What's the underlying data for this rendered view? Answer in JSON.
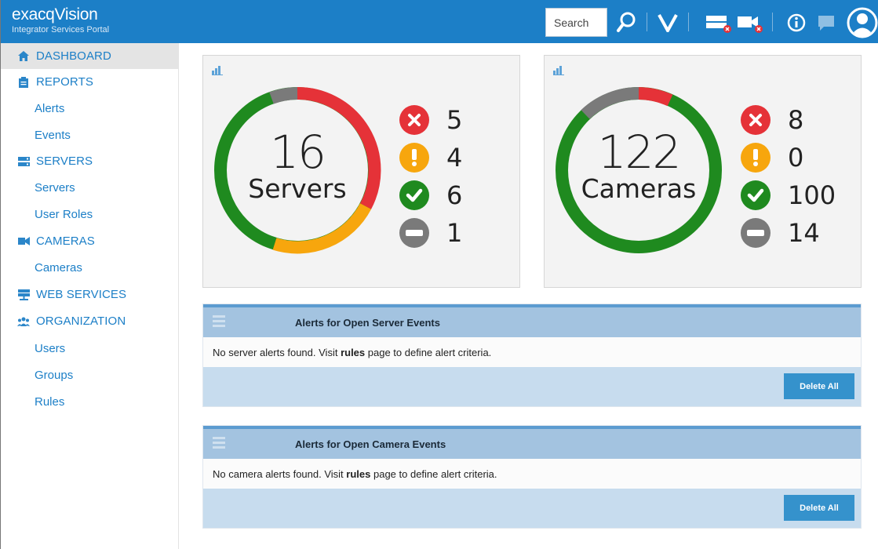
{
  "header": {
    "brand_name": "exacqVision",
    "brand_sub": "Integrator Services Portal",
    "search_placeholder": "Search",
    "icons": [
      "search-icon",
      "vision-logo-icon",
      "server-alert-icon",
      "camera-alert-icon",
      "info-icon",
      "chat-icon",
      "user-avatar-icon"
    ]
  },
  "sidebar": {
    "dashboard": "DASHBOARD",
    "reports": "REPORTS",
    "alerts": "Alerts",
    "events": "Events",
    "servers_section": "SERVERS",
    "servers": "Servers",
    "user_roles": "User Roles",
    "cameras_section": "CAMERAS",
    "cameras": "Cameras",
    "web_services": "WEB SERVICES",
    "organization": "ORGANIZATION",
    "users": "Users",
    "groups": "Groups",
    "rules": "Rules"
  },
  "servers_card": {
    "total": "16",
    "label": "Servers",
    "error": "5",
    "warning": "4",
    "ok": "6",
    "disabled": "1"
  },
  "cameras_card": {
    "total": "122",
    "label": "Cameras",
    "error": "8",
    "warning": "0",
    "ok": "100",
    "disabled": "14"
  },
  "server_alerts": {
    "title": "Alerts for Open Server Events",
    "msg_pre": "No server alerts found. Visit ",
    "msg_link": "rules",
    "msg_post": " page to define alert criteria.",
    "delete": "Delete All"
  },
  "camera_alerts": {
    "title": "Alerts for Open Camera Events",
    "msg_pre": "No camera alerts found. Visit ",
    "msg_link": "rules",
    "msg_post": " page to define alert criteria.",
    "delete": "Delete All"
  },
  "colors": {
    "header": "#1c7fc7",
    "error": "#e53238",
    "warning": "#f7a60d",
    "ok": "#1f8a1f",
    "disabled": "#7a7a7a"
  }
}
